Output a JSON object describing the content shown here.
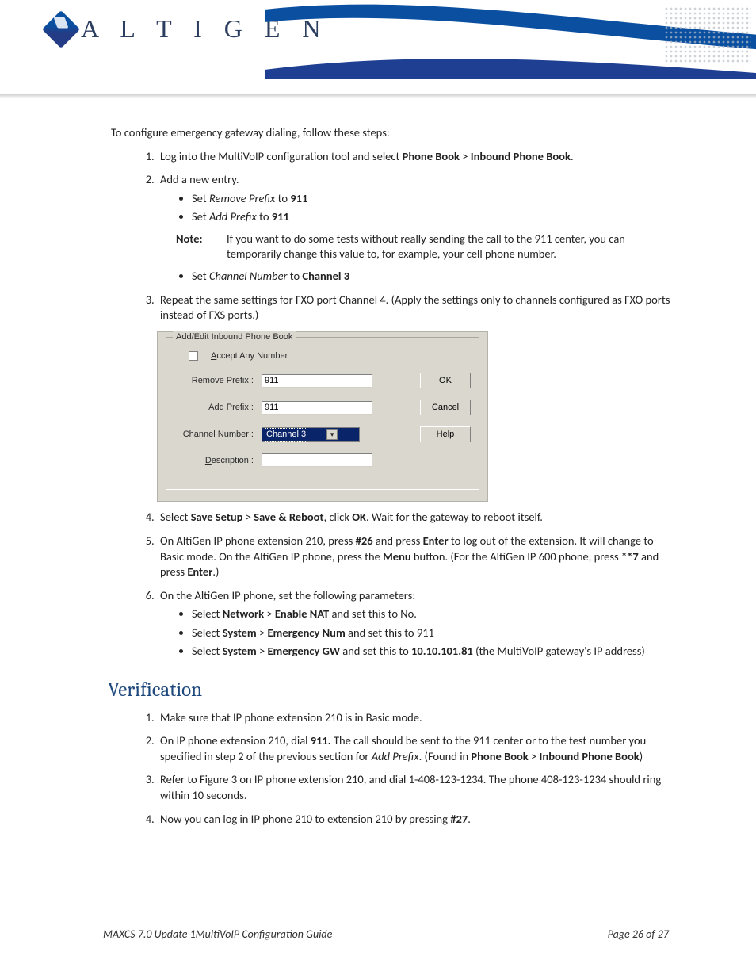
{
  "brand": {
    "name": "AltiGen",
    "logo_letters": "A L T I G E N"
  },
  "intro": "To configure emergency gateway dialing, follow these steps:",
  "steps": {
    "s1": {
      "pre": "Log into the MultiVoIP configuration tool and select ",
      "b1": "Phone Book",
      "mid": " > ",
      "b2": "Inbound Phone Book",
      "post": "."
    },
    "s2": {
      "text": "Add a new entry."
    },
    "s2sub": {
      "a": {
        "pre": "Set ",
        "it": "Remove Prefix",
        "mid": " to ",
        "b": "911"
      },
      "b": {
        "pre": "Set ",
        "it": "Add Prefix",
        "mid": " to ",
        "b": "911"
      },
      "c": {
        "pre": "Set ",
        "it": "Channel Number",
        "mid": " to ",
        "b": "Channel 3"
      }
    },
    "note": {
      "label": "Note:",
      "text": "If you want to do some tests without really sending the call to the 911 center, you can temporarily change this value to, for example, your cell phone number."
    },
    "s3": "Repeat the same settings for FXO port Channel 4. (Apply the settings only to channels configured as FXO ports instead of FXS ports.)",
    "s4": {
      "a": "Select ",
      "b1": "Save Setup",
      "m1": " > ",
      "b2": "Save & Reboot",
      "m2": ", click ",
      "b3": "OK",
      "post": ".  Wait for the gateway to reboot itself."
    },
    "s5": {
      "a": "On AltiGen IP phone extension 210, press ",
      "b1": "#26",
      "m1": " and press ",
      "b2": "Enter",
      "m2": " to log out of the extension. It will change to Basic mode. On the AltiGen IP phone, press the ",
      "b3": "Menu",
      "m3": " button. (For the AltiGen IP 600 phone, press ",
      "b4": "**7",
      "m4": " and press ",
      "b5": "Enter",
      "post": ".)"
    },
    "s6": {
      "lead": "On the AltiGen IP phone, set the following parameters:",
      "a": {
        "pre": "Select ",
        "b1": "Network",
        "m": " > ",
        "b2": "Enable NAT",
        "post": " and set this to No."
      },
      "b": {
        "pre": "Select ",
        "b1": "System",
        "m": " > ",
        "b2": "Emergency Num",
        "post": " and set this to 911"
      },
      "c": {
        "pre": "Select ",
        "b1": "System",
        "m": " > ",
        "b2": "Emergency GW",
        "mid": " and set this to ",
        "b3": "10.10.101.81",
        "post": " (the MultiVoIP gateway's IP address)"
      }
    }
  },
  "dialog": {
    "title": "Add/Edit Inbound Phone Book",
    "accept_any": "Accept Any Number",
    "remove_prefix_label": "Remove Prefix :",
    "remove_prefix_value": "911",
    "add_prefix_label": "Add Prefix :",
    "add_prefix_value": "911",
    "channel_label": "Channel Number :",
    "channel_value": "Channel 3",
    "description_label": "Description :",
    "description_value": "",
    "ok": "OK",
    "cancel": "Cancel",
    "help": "Help"
  },
  "verification": {
    "heading": "Verification",
    "v1": "Make sure that IP phone extension 210 is in Basic mode.",
    "v2": {
      "a": "On IP phone extension 210, dial ",
      "b1": "911.",
      "m1": " The call should be sent to the 911 center or to the test number you specified in step 2 of the previous section for ",
      "it": "Add Prefix",
      "m2": ". (Found in ",
      "b2": "Phone Book",
      "m3": " > ",
      "b3": "Inbound Phone Book",
      "post": ")"
    },
    "v3": "Refer to Figure 3 on IP phone extension 210, and dial 1-408-123-1234. The phone 408-123-1234 should ring within 10 seconds.",
    "v4": {
      "a": "Now you can log in IP phone 210 to extension 210 by pressing ",
      "b": "#27",
      "post": "."
    }
  },
  "footer": {
    "left": "MAXCS 7.0 Update 1MultiVoIP Configuration Guide",
    "right": "Page 26 of 27"
  }
}
